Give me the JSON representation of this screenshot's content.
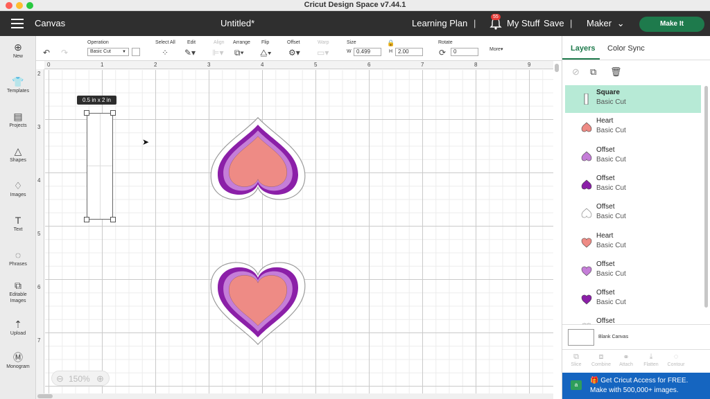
{
  "window": {
    "title": "Cricut Design Space  v7.44.1"
  },
  "header": {
    "canvas_label": "Canvas",
    "project_name": "Untitled*",
    "learning_plan": "Learning Plan",
    "separator": "|",
    "notification_count": "55",
    "my_stuff": "My Stuff",
    "save": "Save",
    "machine": "Maker",
    "make_it": "Make It"
  },
  "toolbar": {
    "operation_label": "Operation",
    "operation_value": "Basic Cut",
    "select_all": "Select All",
    "edit": "Edit",
    "align": "Align",
    "arrange": "Arrange",
    "flip": "Flip",
    "offset": "Offset",
    "warp": "Warp",
    "size_label": "Size",
    "w_label": "W",
    "w_value": "0.499",
    "h_label": "H",
    "h_value": "2.00",
    "rotate_label": "Rotate",
    "rotate_value": "0",
    "more": "More"
  },
  "left_nav": [
    {
      "icon": "plus-circle-icon",
      "glyph": "⊕",
      "label": "New"
    },
    {
      "icon": "shirt-icon",
      "glyph": "👕",
      "label": "Templates"
    },
    {
      "icon": "projects-icon",
      "glyph": "▤",
      "label": "Projects"
    },
    {
      "icon": "shapes-icon",
      "glyph": "△",
      "label": "Shapes"
    },
    {
      "icon": "bulb-icon",
      "glyph": "♢",
      "label": "Images"
    },
    {
      "icon": "text-icon",
      "glyph": "T",
      "label": "Text"
    },
    {
      "icon": "speech-bubble-icon",
      "glyph": "◌",
      "label": "Phrases"
    },
    {
      "icon": "editable-images-icon",
      "glyph": "⧉",
      "label": "Editable\nImages"
    },
    {
      "icon": "upload-icon",
      "glyph": "⇡",
      "label": "Upload"
    },
    {
      "icon": "monogram-icon",
      "glyph": "Ⓜ",
      "label": "Monogram"
    }
  ],
  "canvas": {
    "ruler_top": [
      "0",
      "1",
      "2",
      "3",
      "4",
      "5",
      "6",
      "7",
      "8",
      "9"
    ],
    "ruler_left": [
      "2",
      "3",
      "4",
      "5",
      "6",
      "7"
    ],
    "size_tooltip": "0.5  in x 2  in",
    "zoom": "150%",
    "colors": {
      "outer_offset": "#ffffff",
      "dark_offset": "#8b1fa8",
      "light_offset": "#c57ed8",
      "heart": "#ee8b85"
    }
  },
  "right_panel": {
    "tabs": [
      "Layers",
      "Color Sync"
    ],
    "layers": [
      {
        "name": "Square",
        "operation": "Basic Cut",
        "thumb": "square",
        "color": "#ffffff"
      },
      {
        "name": "Heart",
        "operation": "Basic Cut",
        "thumb": "heart-down",
        "color": "#ee8b85"
      },
      {
        "name": "Offset",
        "operation": "Basic Cut",
        "thumb": "heart-down",
        "color": "#c57ed8"
      },
      {
        "name": "Offset",
        "operation": "Basic Cut",
        "thumb": "heart-down",
        "color": "#8b1fa8"
      },
      {
        "name": "Offset",
        "operation": "Basic Cut",
        "thumb": "heart-down",
        "color": "#ffffff"
      },
      {
        "name": "Heart",
        "operation": "Basic Cut",
        "thumb": "heart",
        "color": "#ee8b85"
      },
      {
        "name": "Offset",
        "operation": "Basic Cut",
        "thumb": "heart",
        "color": "#c57ed8"
      },
      {
        "name": "Offset",
        "operation": "Basic Cut",
        "thumb": "heart",
        "color": "#8b1fa8"
      },
      {
        "name": "Offset",
        "operation": "",
        "thumb": "heart",
        "color": "#ffffff"
      }
    ],
    "blank_canvas": "Blank Canvas",
    "bottom_actions": [
      "Slice",
      "Combine",
      "Attach",
      "Flatten",
      "Contour"
    ],
    "promo_line1": "Get Cricut Access for FREE.",
    "promo_line2": "Make with 500,000+ images."
  }
}
